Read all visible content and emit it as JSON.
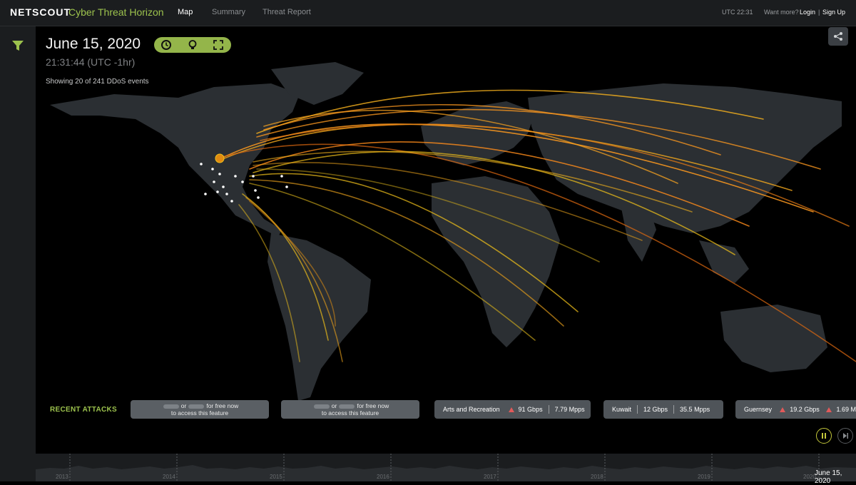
{
  "header": {
    "brand": "NETSCOUT",
    "product": "Cyber Threat Horizon",
    "nav": [
      {
        "label": "Map",
        "active": true
      },
      {
        "label": "Summary",
        "active": false
      },
      {
        "label": "Threat Report",
        "active": false
      }
    ],
    "utc": "UTC 22:31",
    "want_more": "Want more?",
    "login": "Login",
    "divider": "|",
    "signup": "Sign Up"
  },
  "map": {
    "date": "June 15, 2020",
    "time": "21:31:44 (UTC -1hr)",
    "showing": "Showing 20 of 241 DDoS events",
    "controls": [
      "clock-icon",
      "lightbulb-icon",
      "fullscreen-icon"
    ],
    "accent": "#9cc24d",
    "arc_colors": [
      "#ff9a1f",
      "#f2c21a",
      "#e06a10"
    ]
  },
  "recent": {
    "label": "RECENT ATTACKS",
    "locked_text_or": "or",
    "locked_text_rest": "for free now",
    "locked_text_line2": "to access this feature",
    "cards": [
      {
        "name": "Arts and Recreation",
        "gbps": "91 Gbps",
        "mpps": "7.79 Mpps",
        "alert": true
      },
      {
        "name": "Kuwait",
        "gbps": "12 Gbps",
        "mpps": "35.5 Mpps",
        "alert": false
      },
      {
        "name": "Guernsey",
        "gbps": "19.2 Gbps",
        "mpps": "1.69 M",
        "alert": true
      }
    ]
  },
  "timeline": {
    "years": [
      "2013",
      "2014",
      "2015",
      "2016",
      "2017",
      "2018",
      "2019",
      "2020"
    ],
    "current": "June 15, 2020"
  }
}
